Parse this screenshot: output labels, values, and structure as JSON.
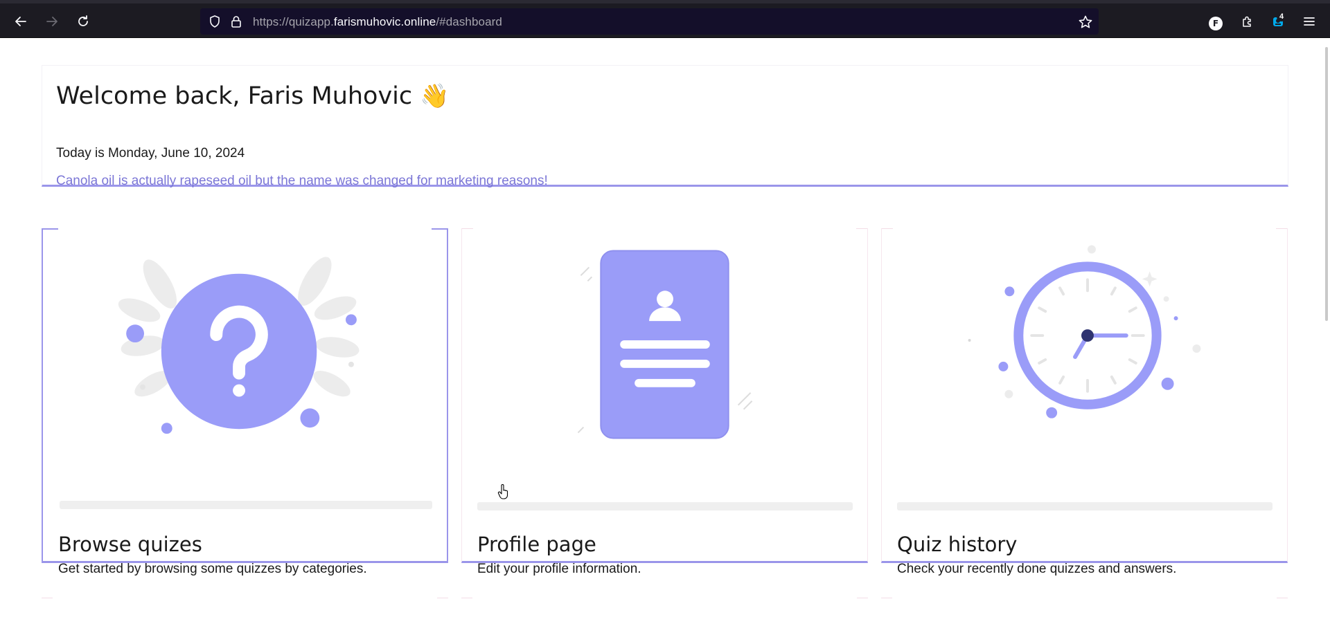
{
  "browser": {
    "url_prefix": "https://quizapp.",
    "url_domain": "farismuhovic.online",
    "url_suffix": "/#dashboard",
    "profile_initial": "F",
    "extension_badge": "4"
  },
  "welcome": {
    "greeting": "Welcome back, Faris Muhovic",
    "emoji": "👋",
    "date_line": "Today is Monday, June 10, 2024",
    "fun_fact": "Canola oil is actually rapeseed oil but the name was changed for marketing reasons!"
  },
  "cards": [
    {
      "title": "Browse quizes",
      "description": "Get started by browsing some quizzes by categories.",
      "icon": "question-icon"
    },
    {
      "title": "Profile page",
      "description": "Edit your profile information.",
      "icon": "profile-card-icon"
    },
    {
      "title": "Quiz history",
      "description": "Check your recently done quizzes and answers.",
      "icon": "clock-icon"
    }
  ],
  "colors": {
    "accent": "#9a95ea",
    "fact_text": "#7b76d6",
    "chrome_bg": "#1c1b22",
    "urlbar_bg": "#140f2a"
  }
}
